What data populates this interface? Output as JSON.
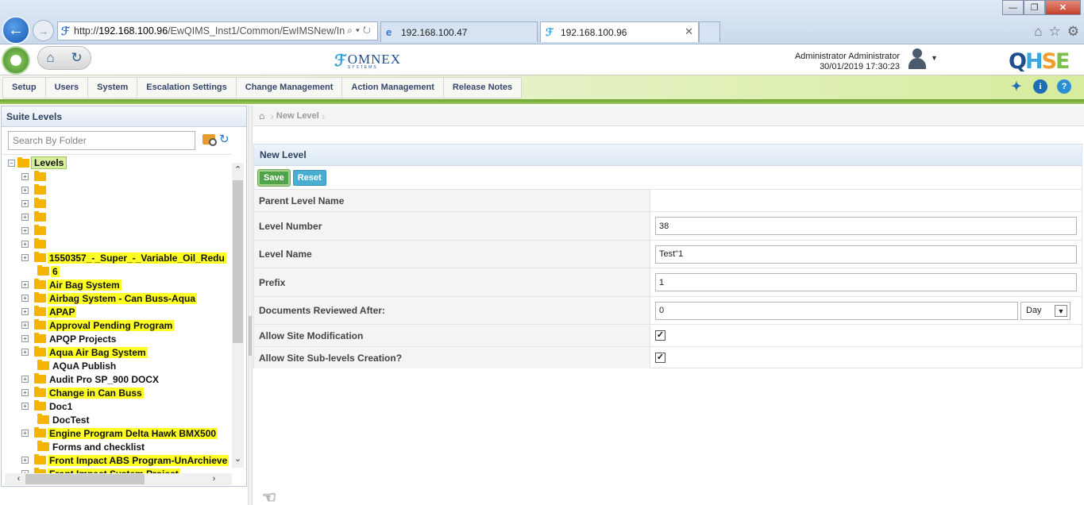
{
  "browser": {
    "url_prefix": "http://",
    "url_host": "192.168.100.96",
    "url_path": "/EwQIMS_Inst1/Common/EwIMSNew/In",
    "tabs": [
      {
        "label": "192.168.100.47",
        "active": false
      },
      {
        "label": "192.168.100.96",
        "active": true
      }
    ]
  },
  "header": {
    "logo_name": "OMNEX",
    "logo_sub": "SYSTEMS",
    "user_name": "Administrator Administrator",
    "datetime": "30/01/2019 17:30:23",
    "qhse": [
      "Q",
      "H",
      "S",
      "E"
    ]
  },
  "menu": {
    "items": [
      "Setup",
      "Users",
      "System",
      "Escalation Settings",
      "Change Management",
      "Action Management",
      "Release Notes"
    ]
  },
  "left_panel": {
    "title": "Suite Levels",
    "search_placeholder": "Search By Folder",
    "root_label": "Levels",
    "items": [
      {
        "label": "",
        "expandable": true,
        "highlighted": true
      },
      {
        "label": "",
        "expandable": true,
        "highlighted": true
      },
      {
        "label": "",
        "expandable": true,
        "highlighted": true
      },
      {
        "label": "",
        "expandable": true,
        "highlighted": true
      },
      {
        "label": "",
        "expandable": true,
        "highlighted": true
      },
      {
        "label": "",
        "expandable": true,
        "highlighted": true
      },
      {
        "label": "1550357_-_Super_-_Variable_Oil_Redu",
        "expandable": true,
        "highlighted": true
      },
      {
        "label": "6",
        "expandable": false,
        "highlighted": true
      },
      {
        "label": "Air Bag System",
        "expandable": true,
        "highlighted": true
      },
      {
        "label": "Airbag System - Can Buss-Aqua",
        "expandable": true,
        "highlighted": true
      },
      {
        "label": "APAP",
        "expandable": true,
        "highlighted": true
      },
      {
        "label": "Approval Pending Program",
        "expandable": true,
        "highlighted": true
      },
      {
        "label": "APQP Projects",
        "expandable": true,
        "highlighted": false
      },
      {
        "label": "Aqua Air Bag System",
        "expandable": true,
        "highlighted": true
      },
      {
        "label": "AQuA Publish",
        "expandable": false,
        "highlighted": false
      },
      {
        "label": "Audit Pro SP_900 DOCX",
        "expandable": true,
        "highlighted": false
      },
      {
        "label": "Change in Can Buss",
        "expandable": true,
        "highlighted": true
      },
      {
        "label": "Doc1",
        "expandable": true,
        "highlighted": false
      },
      {
        "label": "DocTest",
        "expandable": false,
        "highlighted": false
      },
      {
        "label": "Engine Program Delta Hawk BMX500",
        "expandable": true,
        "highlighted": true
      },
      {
        "label": "Forms and checklist",
        "expandable": false,
        "highlighted": false
      },
      {
        "label": "Front Impact ABS Program-UnArchieve",
        "expandable": true,
        "highlighted": true
      },
      {
        "label": "Front Impact System Project",
        "expandable": true,
        "highlighted": true
      }
    ]
  },
  "breadcrumb": {
    "current": "New Level"
  },
  "form": {
    "title": "New Level",
    "save_label": "Save",
    "reset_label": "Reset",
    "parent_level_label": "Parent Level Name",
    "parent_level_value": "",
    "level_number_label": "Level Number",
    "level_number_value": "38",
    "level_name_label": "Level Name",
    "level_name_value": "Test\"1",
    "prefix_label": "Prefix",
    "prefix_value": "1",
    "docs_reviewed_label": "Documents Reviewed After:",
    "docs_reviewed_value": "0",
    "docs_reviewed_unit": "Day",
    "allow_site_mod_label": "Allow Site Modification",
    "allow_site_mod_checked": true,
    "allow_sublevels_label": "Allow Site Sub-levels Creation?",
    "allow_sublevels_checked": true
  },
  "colors": {
    "highlight": "#ffff24",
    "menu_accent": "#6aa230",
    "save_button": "#4fa34b",
    "reset_button": "#4aaed0"
  }
}
